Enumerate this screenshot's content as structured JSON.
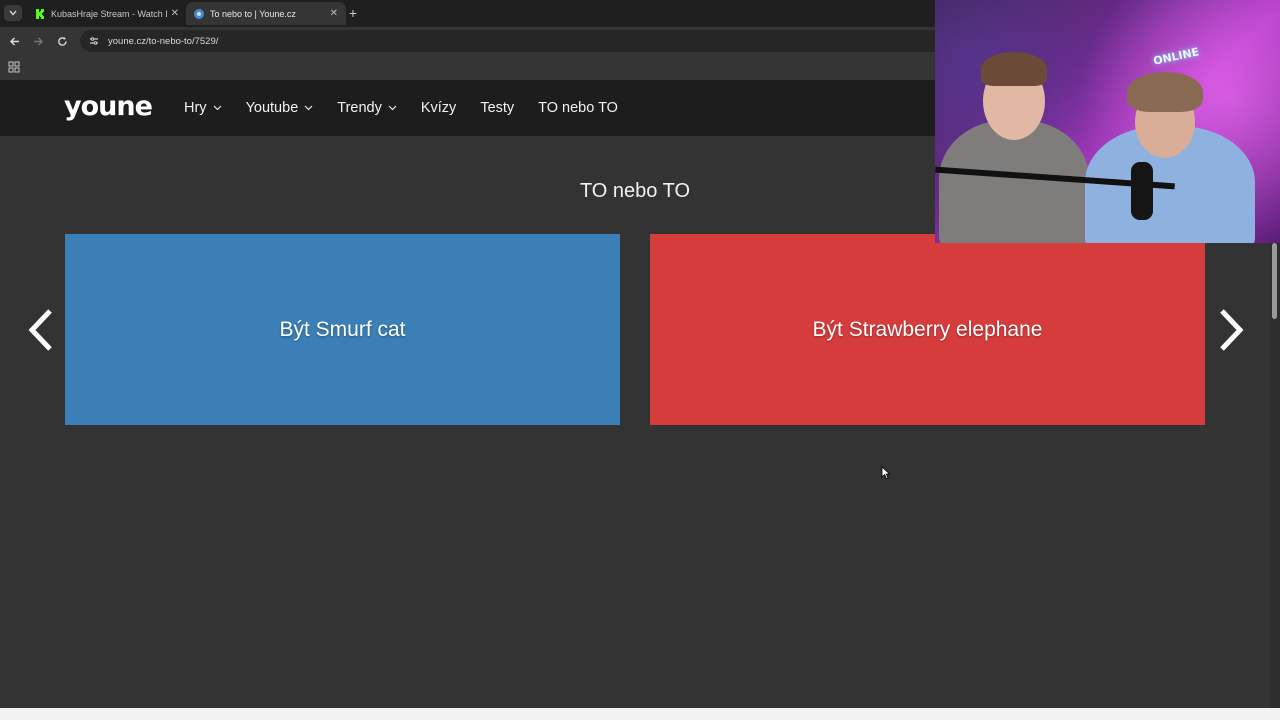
{
  "browser": {
    "tabs": [
      {
        "title": "KubasHraje Stream - Watch Live",
        "active": false,
        "favicon": "kick-icon"
      },
      {
        "title": "To nebo to | Youne.cz",
        "active": true,
        "favicon": "youne-icon"
      }
    ],
    "close_glyph": "✕",
    "new_tab_glyph": "+",
    "url": "youne.cz/to-nebo-to/7529/"
  },
  "site": {
    "logo": "youne",
    "nav": [
      {
        "label": "Hry",
        "dropdown": true
      },
      {
        "label": "Youtube",
        "dropdown": true
      },
      {
        "label": "Trendy",
        "dropdown": true
      },
      {
        "label": "Kvízy",
        "dropdown": false
      },
      {
        "label": "Testy",
        "dropdown": false
      },
      {
        "label": "TO nebo TO",
        "dropdown": false
      }
    ]
  },
  "main": {
    "title": "TO nebo TO",
    "choice_left": {
      "label": "Být Smurf cat",
      "color": "#3b7fb6"
    },
    "choice_right": {
      "label": "Být Strawberry elephane",
      "color": "#d73c3c"
    }
  },
  "webcam": {
    "neon_sign": "ONLINE"
  }
}
